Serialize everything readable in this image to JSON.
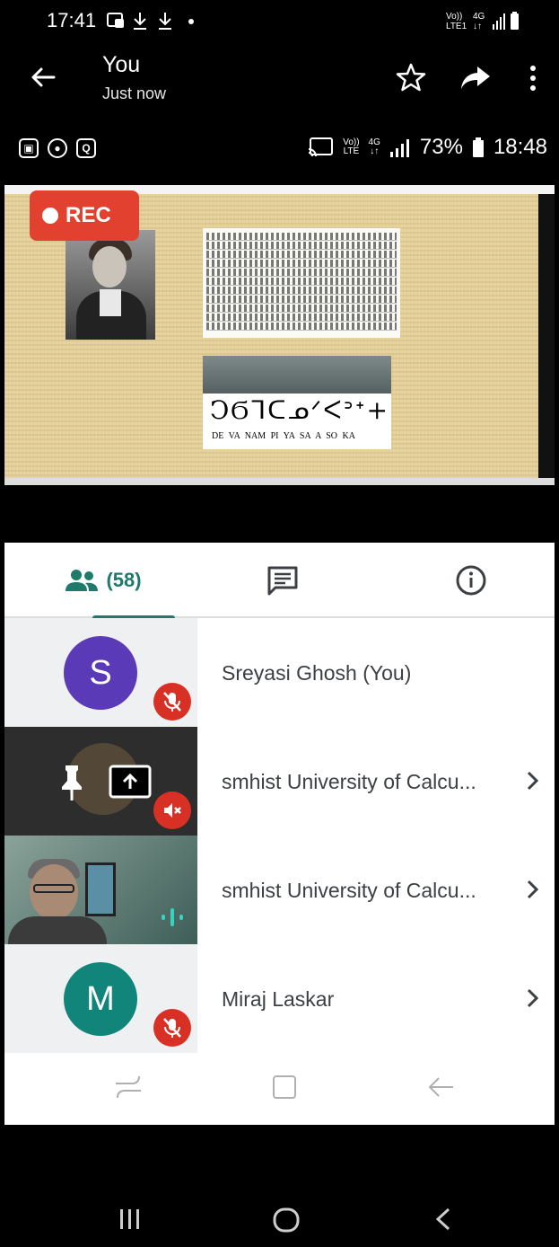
{
  "outer_status": {
    "time": "17:41",
    "battery_icon": "battery-icon",
    "signal": "4G"
  },
  "app_bar": {
    "title": "You",
    "subtitle": "Just now"
  },
  "inner_status": {
    "battery": "73%",
    "time": "18:48"
  },
  "slide": {
    "rec_label": "REC",
    "glyphs": "ϽϬᒣᑕᓄᐟᐸᐣᐩ+",
    "syllables": "DE VA NAM PI YA SA A SO KA"
  },
  "tabs": {
    "people_count": "(58)"
  },
  "participants": [
    {
      "name": "Sreyasi Ghosh (You)",
      "initial": "S",
      "color": "#5b3ab7"
    },
    {
      "name": "smhist University of Calcu..."
    },
    {
      "name": "smhist University of Calcu..."
    },
    {
      "name": "Miraj Laskar",
      "initial": "M",
      "color": "#12857a"
    }
  ]
}
